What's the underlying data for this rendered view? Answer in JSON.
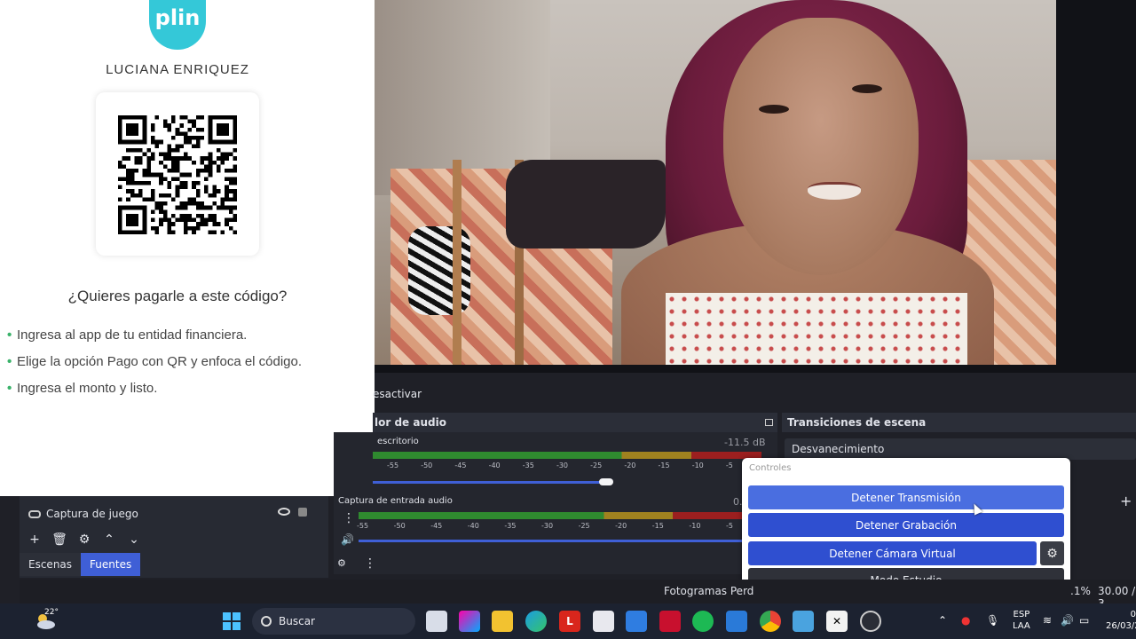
{
  "plin": {
    "logo_text": "plin",
    "account_name": "LUCIANA ENRIQUEZ",
    "question": "¿Quieres pagarle a este código?",
    "steps": [
      "Ingresa al app de tu entidad financiera.",
      "Elige la opción Pago con QR y enfoca el código.",
      "Ingresa el monto y listo."
    ]
  },
  "sources": {
    "item_label": "Captura de juego",
    "toolbar": [
      "+",
      "🗑",
      "⚙",
      "⌃",
      "⌄"
    ]
  },
  "dock_tabs": [
    {
      "label": "Escenas",
      "active": false
    },
    {
      "label": "Fuentes",
      "active": true
    }
  ],
  "mixer": {
    "deactivate_label": "esactivar",
    "header": "lor de audio",
    "tracks": [
      {
        "name": "escritorio",
        "db": "-11.5 dB",
        "level": 0.62
      },
      {
        "name": "Captura de entrada audio",
        "db": "0.",
        "level": 0.0
      }
    ],
    "scale": [
      "-55",
      "-50",
      "-45",
      "-40",
      "-35",
      "-30",
      "-25",
      "-20",
      "-15",
      "-10",
      "-5"
    ]
  },
  "transitions": {
    "header": "Transiciones de escena",
    "selected": "Desvanecimiento",
    "add_label": "+"
  },
  "controls": {
    "title": "Controles",
    "stop_stream": "Detener Transmisión",
    "stop_recording": "Detener Grabación",
    "stop_virtual_cam": "Detener Cámara Virtual",
    "studio_mode": "Modo Estudio",
    "settings_icon": "gear-icon"
  },
  "status": {
    "frames": "Fotogramas Perd",
    "pct": ".1%",
    "fps": "30.00 / 3"
  },
  "taskbar": {
    "temperature": "22°",
    "search_placeholder": "Buscar",
    "lang_top": "ESP",
    "lang_bottom": "LAA",
    "time": "0",
    "date": "26/03/2"
  }
}
